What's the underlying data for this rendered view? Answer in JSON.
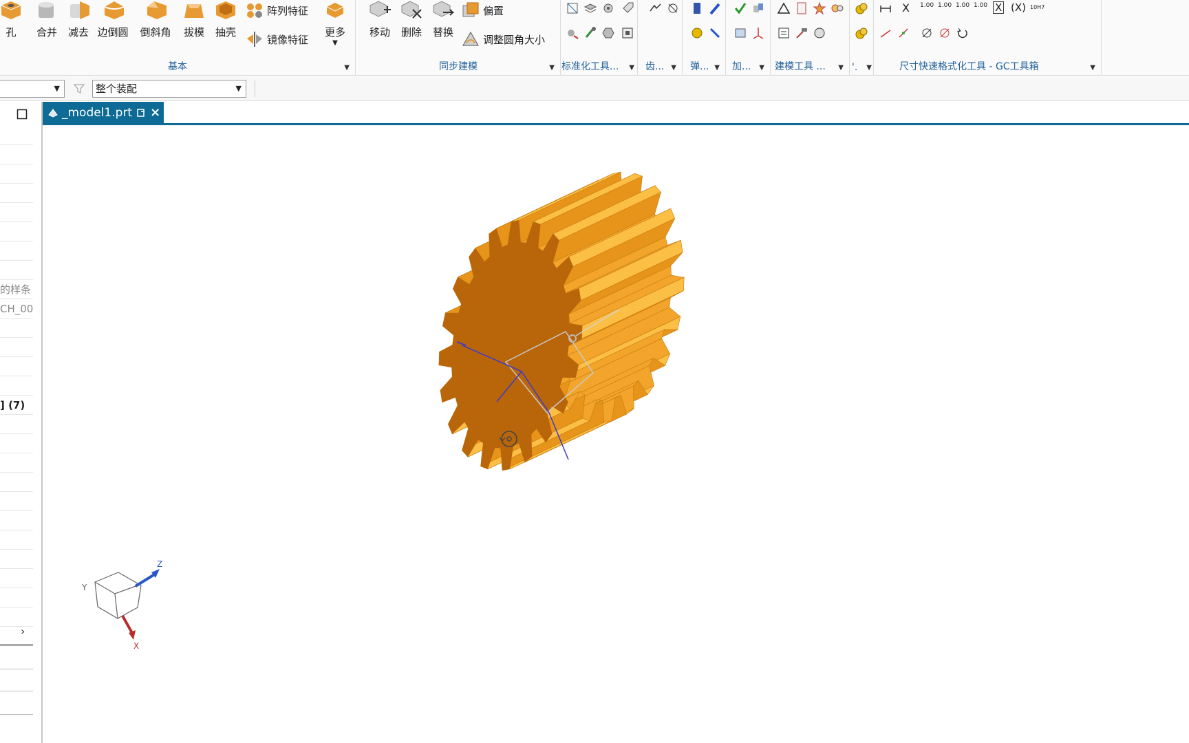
{
  "ribbon": {
    "basic": {
      "buttons": [
        "孔",
        "合并",
        "减去",
        "边倒圆",
        "倒斜角",
        "拔模",
        "抽壳"
      ],
      "pattern_feature": "阵列特征",
      "mirror_feature": "镜像特征",
      "more": "更多",
      "group_label": "基本"
    },
    "sync": {
      "buttons": [
        "移动",
        "删除",
        "替换"
      ],
      "offset": "偏置",
      "resize_blend": "调整圆角大小",
      "group_label": "同步建模"
    },
    "groups": {
      "standard_tools": "标准化工具...",
      "gear": "齿...",
      "spring": "弹...",
      "machining": "加...",
      "modeling_tools": "建模工具 ...",
      "dot": "'.",
      "gc_toolbox": "尺寸快速格式化工具 - GC工具箱"
    },
    "dim_icons": {
      "x": "X",
      "x_box": "X",
      "x_paren": "(X)",
      "fit1": "10H7",
      "v1": "1.00",
      "v2": "1.00",
      "v3": "1.00",
      "v4": "1.00"
    }
  },
  "selection": {
    "filter_value": "",
    "scope_value": "整个装配"
  },
  "nav": {
    "rows": [
      "",
      "",
      "",
      "",
      "",
      "",
      "",
      "",
      "的样条 (",
      "CH_00",
      "",
      "",
      "",
      "",
      "] (7)",
      "",
      "",
      "",
      "",
      "",
      "",
      "",
      "",
      "",
      "",
      ""
    ]
  },
  "tab": {
    "title": "_model1.prt",
    "close": "×"
  },
  "triad": {
    "x": "X",
    "y": "Y",
    "z": "Z"
  },
  "colors": {
    "accent": "#0d6b96",
    "gear_light": "#f7a81e",
    "gear_dark": "#b9650a"
  }
}
